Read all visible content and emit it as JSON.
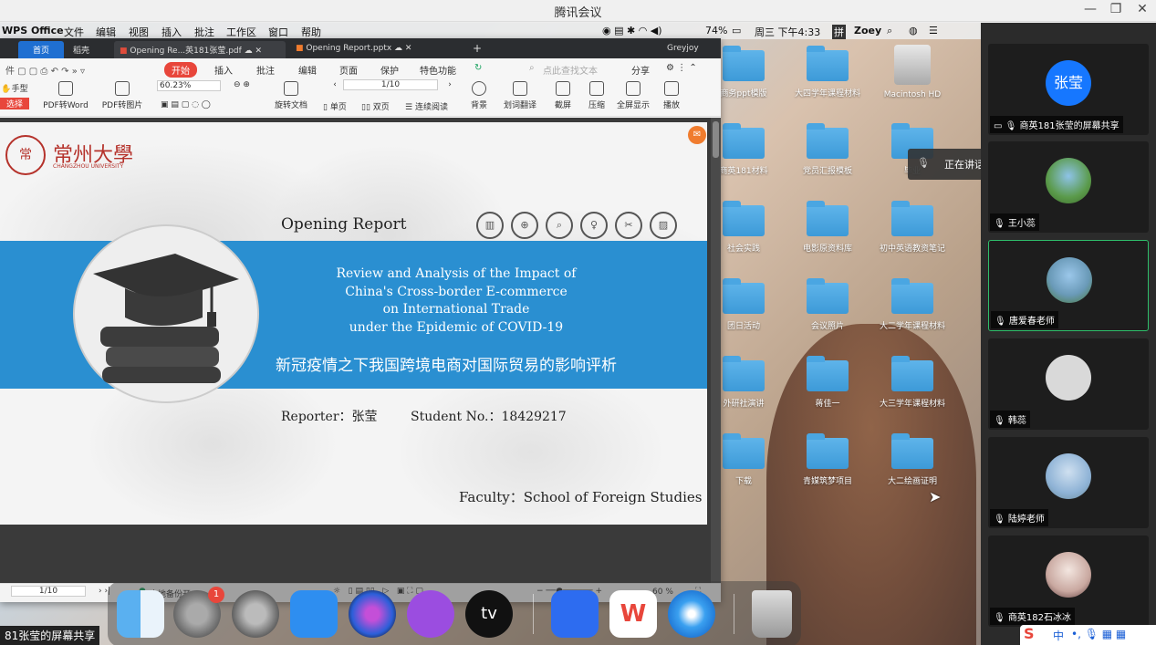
{
  "window": {
    "title": "腾讯会议"
  },
  "mac_menubar": {
    "app": "WPS Office",
    "menus": [
      "文件",
      "编辑",
      "视图",
      "插入",
      "批注",
      "工作区",
      "窗口",
      "帮助"
    ],
    "battery": "74%",
    "datetime": "周三 下午4:33",
    "input": "拼",
    "user": "Zoey"
  },
  "wps": {
    "tabs": [
      "首页",
      "稻壳",
      "Opening Re...英181张莹.pdf",
      "Opening Report.pptx"
    ],
    "account": "Greyjoy",
    "menus": [
      "开始",
      "插入",
      "批注",
      "编辑",
      "页面",
      "保护",
      "特色功能"
    ],
    "search_placeholder": "点此查找文本",
    "share": "分享",
    "tools": [
      "手型",
      "选择",
      "PDF转Word",
      "PDF转图片",
      "旋转文档",
      "单页",
      "双页",
      "连续阅读",
      "背景",
      "划词翻译",
      "截屏",
      "压缩",
      "全屏显示",
      "播放"
    ],
    "zoom": "60.23%",
    "page": "1/10",
    "status": {
      "page": "1/10",
      "backup": "本地备份开",
      "zoom": "60 %"
    }
  },
  "slide": {
    "university": "常州大學",
    "university_en": "CHANGZHOU UNIVERSITY",
    "report_label": "Opening Report",
    "title_en": [
      "Review and Analysis of the Impact of",
      "China's Cross-border E-commerce",
      "on International Trade",
      "under the Epidemic of COVID-19"
    ],
    "title_cn": "新冠疫情之下我国跨境电商对国际贸易的影响评析",
    "reporter": "Reporter：张莹",
    "student_no": "Student No.：18429217",
    "faculty": "Faculty：School of Foreign Studies"
  },
  "desktop": {
    "icons": [
      "商务ppt模版",
      "大四学年课程材料",
      "Macintosh HD",
      "商英181材料",
      "党员汇报模板",
      "毕业",
      "社会实践",
      "电影原资料库",
      "初中英语教资笔记",
      "团日活动",
      "会议照片",
      "大二学年课程材料",
      "外研社演讲",
      "蒋佳一",
      "大三学年课程材料",
      "下载",
      "青媒筑梦项目",
      "大二绘画证明"
    ]
  },
  "dock": {
    "badge": "1"
  },
  "participants": [
    {
      "name": "商英181张莹的屏幕共享",
      "avatar_text": "张莹",
      "color": "#1677ff"
    },
    {
      "name": "王小蕊",
      "color": "#7aa66a"
    },
    {
      "name": "唐爱春老师",
      "color": "#5a8fb5"
    },
    {
      "name": "韩蕊",
      "color": "#d9d9d9"
    },
    {
      "name": "陆婷老师",
      "color": "#8fb3d6"
    },
    {
      "name": "商英182石冰冰",
      "color": "#e3d2cc"
    }
  ],
  "speaking": "正在讲话: 唐爱春老师;",
  "footer_label": "81张莹的屏幕共享",
  "ime": {
    "logo": "S",
    "lang": "中"
  }
}
